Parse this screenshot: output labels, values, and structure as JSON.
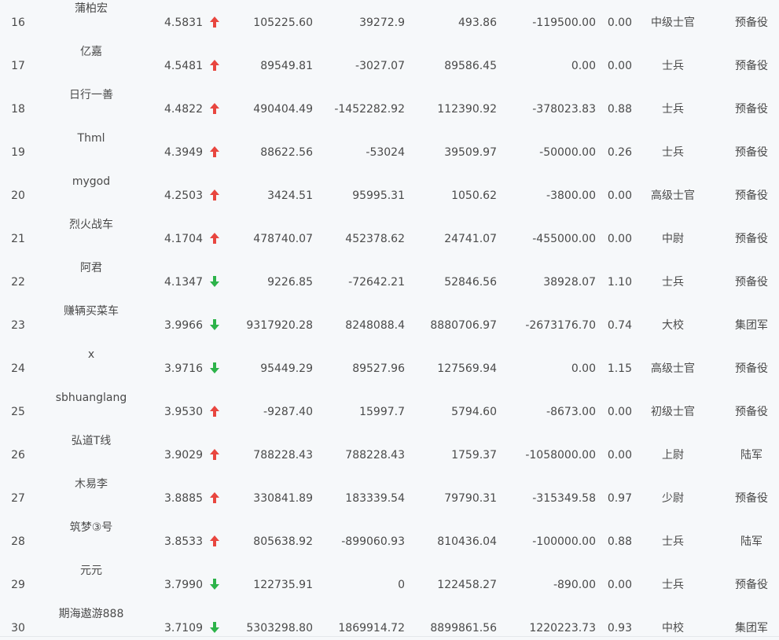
{
  "colors": {
    "up": "#e8463f",
    "down": "#2db34a",
    "text": "#4a4a4a",
    "background": "#f6f8fa"
  },
  "rows": [
    {
      "rank": "16",
      "name": "蒲柏宏",
      "score": "4.5831",
      "trend": "up",
      "c1": "105225.60",
      "c2": "39272.9",
      "c3": "493.86",
      "c4": "-119500.00",
      "c5": "0.00",
      "rank_name": "中级士官",
      "branch": "预备役"
    },
    {
      "rank": "17",
      "name": "亿嘉",
      "score": "4.5481",
      "trend": "up",
      "c1": "89549.81",
      "c2": "-3027.07",
      "c3": "89586.45",
      "c4": "0.00",
      "c5": "0.00",
      "rank_name": "士兵",
      "branch": "预备役"
    },
    {
      "rank": "18",
      "name": "日行一善",
      "score": "4.4822",
      "trend": "up",
      "c1": "490404.49",
      "c2": "-1452282.92",
      "c3": "112390.92",
      "c4": "-378023.83",
      "c5": "0.88",
      "rank_name": "士兵",
      "branch": "预备役"
    },
    {
      "rank": "19",
      "name": "Thml",
      "score": "4.3949",
      "trend": "up",
      "c1": "88622.56",
      "c2": "-53024",
      "c3": "39509.97",
      "c4": "-50000.00",
      "c5": "0.26",
      "rank_name": "士兵",
      "branch": "预备役"
    },
    {
      "rank": "20",
      "name": "mygod",
      "score": "4.2503",
      "trend": "up",
      "c1": "3424.51",
      "c2": "95995.31",
      "c3": "1050.62",
      "c4": "-3800.00",
      "c5": "0.00",
      "rank_name": "高级士官",
      "branch": "预备役"
    },
    {
      "rank": "21",
      "name": "烈火战车",
      "score": "4.1704",
      "trend": "up",
      "c1": "478740.07",
      "c2": "452378.62",
      "c3": "24741.07",
      "c4": "-455000.00",
      "c5": "0.00",
      "rank_name": "中尉",
      "branch": "预备役"
    },
    {
      "rank": "22",
      "name": "阿君",
      "score": "4.1347",
      "trend": "down",
      "c1": "9226.85",
      "c2": "-72642.21",
      "c3": "52846.56",
      "c4": "38928.07",
      "c5": "1.10",
      "rank_name": "士兵",
      "branch": "预备役"
    },
    {
      "rank": "23",
      "name": "赚辆买菜车",
      "score": "3.9966",
      "trend": "down",
      "c1": "9317920.28",
      "c2": "8248088.4",
      "c3": "8880706.97",
      "c4": "-2673176.70",
      "c5": "0.74",
      "rank_name": "大校",
      "branch": "集团军"
    },
    {
      "rank": "24",
      "name": "x",
      "score": "3.9716",
      "trend": "down",
      "c1": "95449.29",
      "c2": "89527.96",
      "c3": "127569.94",
      "c4": "0.00",
      "c5": "1.15",
      "rank_name": "高级士官",
      "branch": "预备役"
    },
    {
      "rank": "25",
      "name": "sbhuanglang",
      "score": "3.9530",
      "trend": "up",
      "c1": "-9287.40",
      "c2": "15997.7",
      "c3": "5794.60",
      "c4": "-8673.00",
      "c5": "0.00",
      "rank_name": "初级士官",
      "branch": "预备役"
    },
    {
      "rank": "26",
      "name": "弘道T线",
      "score": "3.9029",
      "trend": "up",
      "c1": "788228.43",
      "c2": "788228.43",
      "c3": "1759.37",
      "c4": "-1058000.00",
      "c5": "0.00",
      "rank_name": "上尉",
      "branch": "陆军"
    },
    {
      "rank": "27",
      "name": "木易李",
      "score": "3.8885",
      "trend": "up",
      "c1": "330841.89",
      "c2": "183339.54",
      "c3": "79790.31",
      "c4": "-315349.58",
      "c5": "0.97",
      "rank_name": "少尉",
      "branch": "预备役"
    },
    {
      "rank": "28",
      "name": "筑梦③号",
      "score": "3.8533",
      "trend": "up",
      "c1": "805638.92",
      "c2": "-899060.93",
      "c3": "810436.04",
      "c4": "-100000.00",
      "c5": "0.88",
      "rank_name": "士兵",
      "branch": "陆军"
    },
    {
      "rank": "29",
      "name": "元元",
      "score": "3.7990",
      "trend": "down",
      "c1": "122735.91",
      "c2": "0",
      "c3": "122458.27",
      "c4": "-890.00",
      "c5": "0.00",
      "rank_name": "士兵",
      "branch": "预备役"
    },
    {
      "rank": "30",
      "name": "期海遨游888",
      "score": "3.7109",
      "trend": "down",
      "c1": "5303298.80",
      "c2": "1869914.72",
      "c3": "8899861.56",
      "c4": "1220223.73",
      "c5": "0.93",
      "rank_name": "中校",
      "branch": "集团军"
    }
  ]
}
